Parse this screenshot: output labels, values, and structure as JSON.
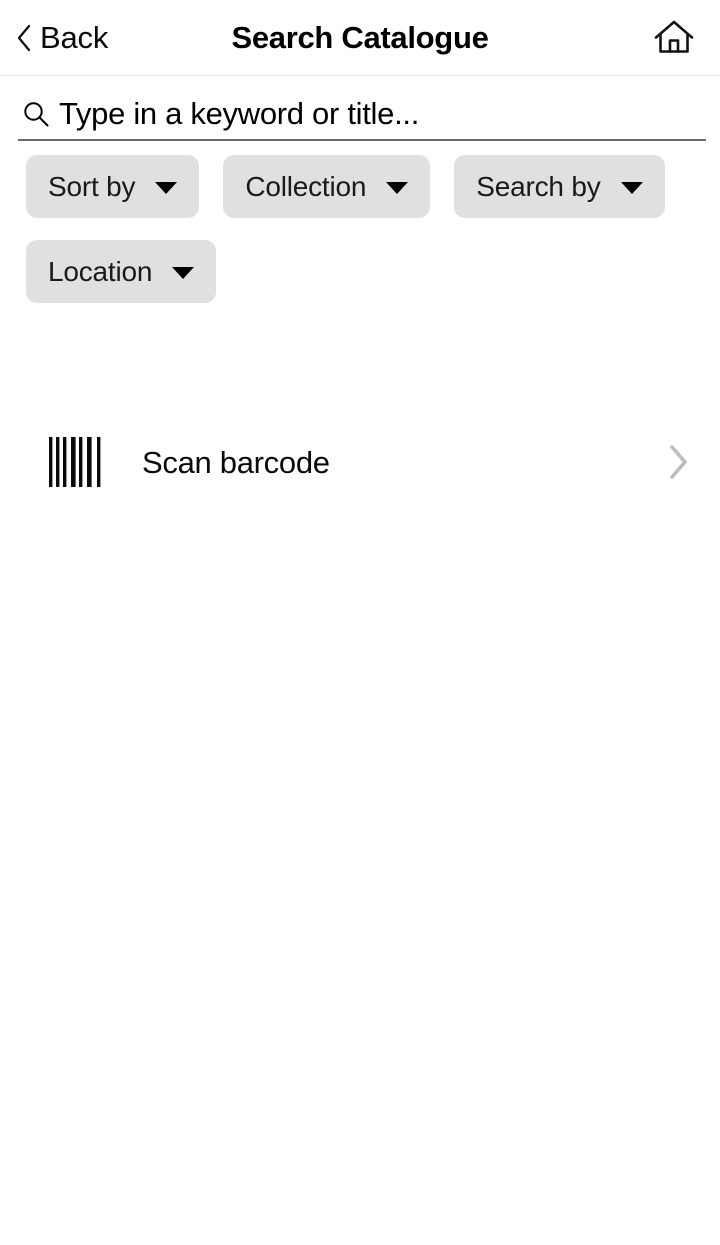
{
  "header": {
    "back_label": "Back",
    "back_icon": "chevron-left-icon",
    "title": "Search Catalogue",
    "home_icon": "home-icon",
    "border_color": "#e8e8e8"
  },
  "search": {
    "icon": "search-icon",
    "value": "",
    "placeholder": "Type in a keyword or title...",
    "underline_color": "#6b6b70"
  },
  "filters": {
    "chip_bg": "#e0e0e0",
    "caret_icon": "chevron-down-icon",
    "chips": [
      {
        "label": "Sort by"
      },
      {
        "label": "Collection"
      },
      {
        "label": "Search by"
      },
      {
        "label": "Location"
      }
    ]
  },
  "scan": {
    "icon": "barcode-icon",
    "label": "Scan barcode",
    "chevron_icon": "chevron-right-icon",
    "chevron_color": "#bcbcbc"
  },
  "theme": {
    "background": "#ffffff",
    "text": "#000000",
    "muted": "#bcbcbc"
  }
}
